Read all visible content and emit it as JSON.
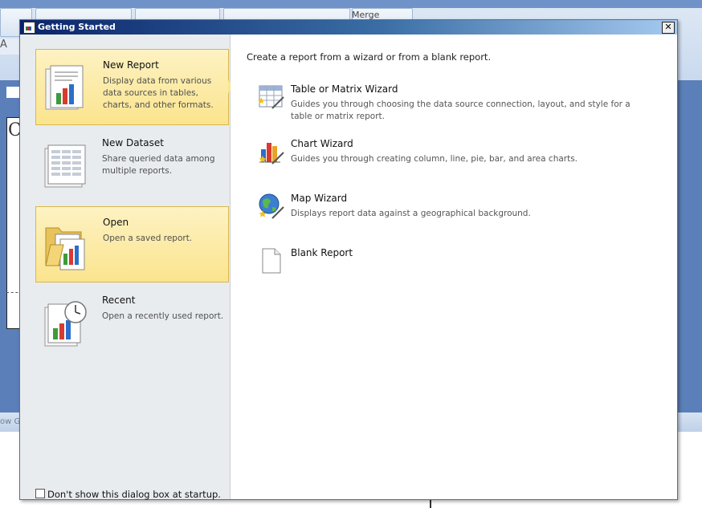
{
  "background": {
    "merge_label": "Merge",
    "canvas_letter": "C",
    "status_text": "ow G"
  },
  "dialog": {
    "title": "Getting Started",
    "close_label": "✕",
    "left_items": [
      {
        "title": "New Report",
        "description": "Display data from various data sources in tables, charts, and other formats.",
        "selected": true
      },
      {
        "title": "New Dataset",
        "description": "Share queried data among multiple reports.",
        "selected": false
      },
      {
        "title": "Open",
        "description": "Open a saved report.",
        "selected": true
      },
      {
        "title": "Recent",
        "description": "Open a recently used report.",
        "selected": false
      }
    ],
    "startup_checkbox_label": "Don't show this dialog box at startup.",
    "intro": "Create a report from a wizard or from a blank report.",
    "wizards": [
      {
        "title": "Table or Matrix Wizard",
        "description": "Guides you through choosing the data source connection, layout, and style for a table or matrix report.",
        "icon": "table-wizard-icon"
      },
      {
        "title": "Chart Wizard",
        "description": "Guides you through creating column, line, pie, bar, and area charts.",
        "icon": "chart-wizard-icon"
      },
      {
        "title": "Map Wizard",
        "description": "Displays report data against a geographical background.",
        "icon": "map-wizard-icon"
      },
      {
        "title": "Blank Report",
        "description": "",
        "icon": "blank-report-icon"
      }
    ]
  },
  "colors": {
    "selected_fill": "#fbe48e",
    "selected_border": "#d7b84a",
    "titlebar_start": "#0a246a",
    "app_blue": "#5b7fb9"
  }
}
